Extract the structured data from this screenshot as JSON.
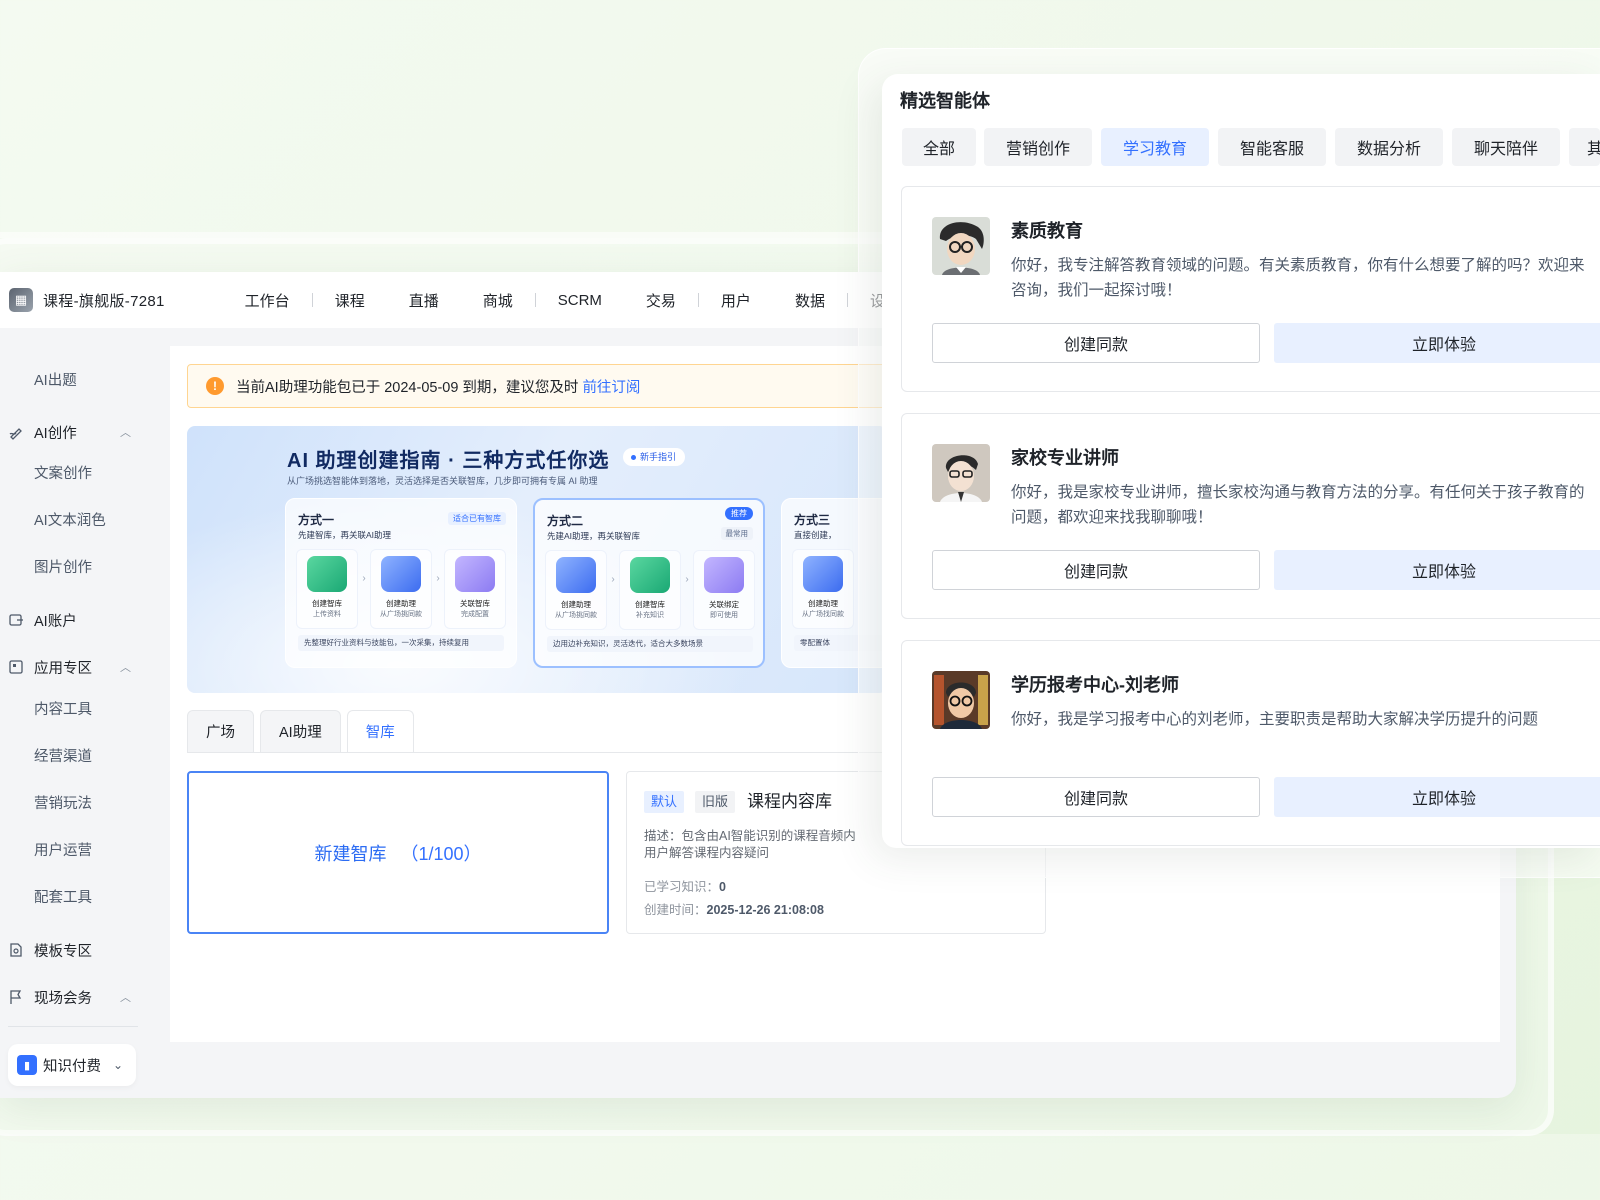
{
  "app": {
    "title": "课程-旗舰版-7281"
  },
  "nav": [
    "工作台",
    "课程",
    "直播",
    "商城",
    "SCRM",
    "交易",
    "用户",
    "数据",
    "设置"
  ],
  "sidebar": {
    "items": [
      {
        "label": "AI出题",
        "type": "sub"
      },
      {
        "label": "AI创作",
        "type": "group",
        "icon": "pen-icon"
      },
      {
        "label": "文案创作",
        "type": "sub"
      },
      {
        "label": "AI文本润色",
        "type": "sub"
      },
      {
        "label": "图片创作",
        "type": "sub"
      },
      {
        "label": "AI账户",
        "type": "group",
        "icon": "account-icon"
      },
      {
        "label": "应用专区",
        "type": "group",
        "icon": "app-icon"
      },
      {
        "label": "内容工具",
        "type": "sub"
      },
      {
        "label": "经营渠道",
        "type": "sub"
      },
      {
        "label": "营销玩法",
        "type": "sub"
      },
      {
        "label": "用户运营",
        "type": "sub"
      },
      {
        "label": "配套工具",
        "type": "sub"
      },
      {
        "label": "模板专区",
        "type": "group",
        "icon": "template-icon"
      },
      {
        "label": "现场会务",
        "type": "group",
        "icon": "flag-icon"
      }
    ],
    "footer_label": "知识付费"
  },
  "alert": {
    "text": "当前AI助理功能包已于 2024-05-09 到期，建议您及时",
    "link": "前往订阅"
  },
  "banner": {
    "title": "AI 助理创建指南 · 三种方式任你选",
    "tag": "新手指引",
    "subtitle": "从广场挑选智能体到落地，灵活选择是否关联智库，几步即可拥有专属 AI 助理",
    "ways": [
      {
        "title": "方式一",
        "subtitle": "先建智库，再关联AI助理",
        "tag": "适合已有智库",
        "steps": [
          {
            "a": "创建智库",
            "b": "上传资料"
          },
          {
            "a": "创建助理",
            "b": "从广场挑同款"
          },
          {
            "a": "关联智库",
            "b": "完成配置"
          }
        ],
        "tip": "先整理好行业资料与技能包，一次采集，持续复用"
      },
      {
        "title": "方式二",
        "subtitle": "先建AI助理，再关联智库",
        "tag": "推荐",
        "tag2": "最常用",
        "steps": [
          {
            "a": "创建助理",
            "b": "从广场挑同款"
          },
          {
            "a": "创建智库",
            "b": "补充知识"
          },
          {
            "a": "关联绑定",
            "b": "即可使用"
          }
        ],
        "tip": "边用边补充知识，灵活迭代，适合大多数场景"
      },
      {
        "title": "方式三",
        "subtitle": "直接创建，",
        "steps": [
          {
            "a": "创建助理",
            "b": "从广场找同款"
          }
        ],
        "tip": "零配置体"
      }
    ]
  },
  "tabs": [
    {
      "label": "广场"
    },
    {
      "label": "AI助理"
    },
    {
      "label": "智库",
      "active": true
    }
  ],
  "new_kb": {
    "label": "新建智库",
    "count": "（1/100）"
  },
  "kb_card": {
    "tag_default": "默认",
    "tag_old": "旧版",
    "name": "课程内容库",
    "desc": "描述：包含由AI智能识别的课程音频内用户解答课程内容疑问",
    "learned_label": "已学习知识：",
    "learned_value": "0",
    "created_label": "创建时间：",
    "created_value": "2025-12-26 21:08:08"
  },
  "agents_panel": {
    "title": "精选智能体",
    "categories": [
      "全部",
      "营销创作",
      "学习教育",
      "智能客服",
      "数据分析",
      "聊天陪伴",
      "其"
    ],
    "active_category": "学习教育",
    "agents": [
      {
        "name": "素质教育",
        "desc": "你好，我专注解答教育领域的问题。有关素质教育，你有什么想要了解的吗？欢迎来咨询，我们一起探讨哦！",
        "clone": "创建同款",
        "try": "立即体验"
      },
      {
        "name": "家校专业讲师",
        "desc": "你好，我是家校专业讲师，擅长家校沟通与教育方法的分享。有任何关于孩子教育的问题，都欢迎来找我聊聊哦！",
        "clone": "创建同款",
        "try": "立即体验"
      },
      {
        "name": "学历报考中心-刘老师",
        "desc": "你好，我是学习报考中心的刘老师，主要职责是帮助大家解决学历提升的问题",
        "clone": "创建同款",
        "try": "立即体验"
      }
    ]
  },
  "colors": {
    "accent": "#3370ff",
    "warning": "#ff9a2e",
    "bg": "#eef8e8"
  }
}
